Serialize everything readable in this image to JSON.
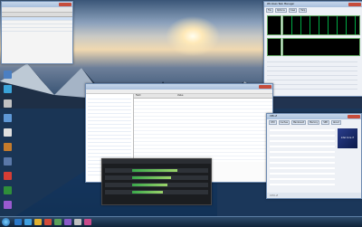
{
  "wallpaper": "mountain-lake-sunset",
  "desktop_icons": [
    {
      "label": "",
      "color": "#4b7fc2"
    },
    {
      "label": "",
      "color": "#3aa3d9"
    },
    {
      "label": "",
      "color": "#c2c2c2"
    },
    {
      "label": "",
      "color": "#5e98d6"
    },
    {
      "label": "",
      "color": "#e0e0e0"
    },
    {
      "label": "",
      "color": "#c47b2c"
    },
    {
      "label": "",
      "color": "#5a78a8"
    },
    {
      "label": "",
      "color": "#d63d35"
    },
    {
      "label": "",
      "color": "#2f8f3a"
    },
    {
      "label": "",
      "color": "#9a5ad0"
    }
  ],
  "windows": {
    "top_left": {
      "title": "",
      "tabs": [],
      "header_values": [],
      "rows": []
    },
    "task_manager": {
      "title": "Windows Task Manager",
      "tabs": [
        "File",
        "Options",
        "View",
        "Help"
      ],
      "stats": []
    },
    "everest": {
      "title": "",
      "menu": [
        "",
        ""
      ],
      "tree": [],
      "detail_header": [
        "Field",
        "Value"
      ],
      "rows": []
    },
    "oc_tool": {
      "title": "",
      "bars": []
    },
    "cpuz": {
      "title": "CPU-Z",
      "tabs": [
        "CPU",
        "Caches",
        "Mainboard",
        "Memory",
        "SPD",
        "About"
      ],
      "logo_text": "intel Core i7",
      "bottom_label": "CPU-Z",
      "version": ""
    }
  },
  "taskbar": {
    "clock": "",
    "date": "",
    "items": [
      "start",
      "ie",
      "explorer",
      "media",
      "app",
      "app",
      "app",
      "app",
      "app"
    ]
  }
}
